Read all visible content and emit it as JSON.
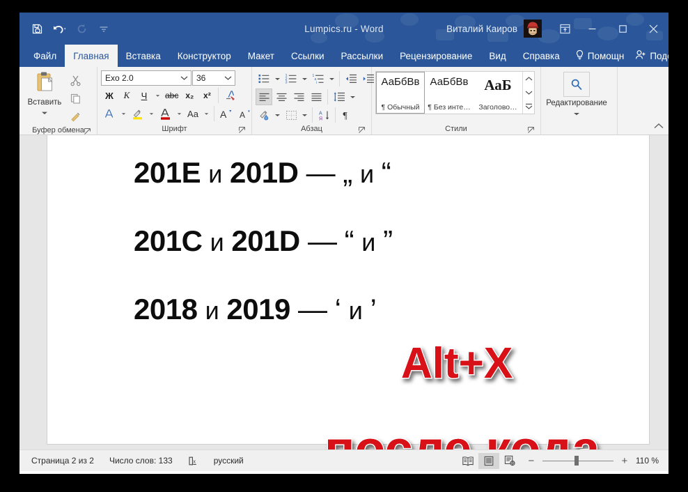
{
  "window": {
    "title": "Lumpics.ru  -  Word",
    "user": "Виталий Каиров",
    "quick_access": [
      {
        "name": "save",
        "label": "Сохранить"
      },
      {
        "name": "undo",
        "label": "Отменить"
      },
      {
        "name": "redo",
        "label": "Вернуть"
      },
      {
        "name": "customize",
        "label": "Настройка панели быстрого доступа"
      }
    ],
    "buttons": {
      "ribbon_display": "Параметры отображения ленты",
      "minimize": "Свернуть",
      "maximize": "Развернуть",
      "close": "Закрыть"
    }
  },
  "tabs": [
    {
      "label": "Файл",
      "active": false
    },
    {
      "label": "Главная",
      "active": true
    },
    {
      "label": "Вставка",
      "active": false
    },
    {
      "label": "Конструктор",
      "active": false
    },
    {
      "label": "Макет",
      "active": false
    },
    {
      "label": "Ссылки",
      "active": false
    },
    {
      "label": "Рассылки",
      "active": false
    },
    {
      "label": "Рецензирование",
      "active": false
    },
    {
      "label": "Вид",
      "active": false
    },
    {
      "label": "Справка",
      "active": false
    }
  ],
  "tabstrip_right": {
    "help_label": "Помощн",
    "share_label": "Поделиться"
  },
  "ribbon": {
    "groups": {
      "clipboard": {
        "label": "Буфер обмена",
        "paste_label": "Вставить",
        "cut_label": "Вырезать",
        "copy_label": "Копировать",
        "format_painter_label": "Формат по образцу"
      },
      "font": {
        "label": "Шрифт",
        "font_name": "Exo 2.0",
        "font_size": "36",
        "bold": "Ж",
        "italic": "К",
        "underline": "Ч",
        "strikethrough": "abc",
        "subscript": "x₂",
        "superscript": "x²",
        "clear_format_label": "Очистить формат",
        "text_effects_label": "Текстовые эффекты",
        "highlight_label": "Цвет выделения текста",
        "font_color_label": "Цвет шрифта",
        "change_case": "Aa",
        "grow_font": "A",
        "shrink_font": "A"
      },
      "paragraph": {
        "label": "Абзац",
        "bullets_label": "Маркеры",
        "numbering_label": "Нумерация",
        "multilevel_label": "Многоуровневый список",
        "decrease_indent_label": "Уменьшить отступ",
        "increase_indent_label": "Увеличить отступ",
        "align_left_label": "По левому краю",
        "align_center_label": "По центру",
        "align_right_label": "По правому краю",
        "justify_label": "По ширине",
        "line_spacing_label": "Интервал",
        "shading_label": "Заливка",
        "borders_label": "Границы",
        "sort_label": "Сортировка",
        "marks_label": "Отобразить все знаки"
      },
      "styles": {
        "label": "Стили",
        "items": [
          {
            "preview": "АаБбВв",
            "name": "¶ Обычный",
            "selected": true,
            "heading": false
          },
          {
            "preview": "АаБбВв",
            "name": "¶ Без инте…",
            "selected": false,
            "heading": false
          },
          {
            "preview": "АаБ",
            "name": "Заголово…",
            "selected": false,
            "heading": true
          }
        ]
      },
      "editing": {
        "label": "Редактирование",
        "icon": "search-icon"
      }
    },
    "collapse_label": "Свернуть ленту"
  },
  "document": {
    "lines": [
      {
        "code1": "201E",
        "conj": "и",
        "code2": "201D",
        "dash": "—",
        "q_open": "„",
        "mid": "и",
        "q_close": "“"
      },
      {
        "code1": "201C",
        "conj": "и",
        "code2": "201D",
        "dash": "—",
        "q_open": "“",
        "mid": "и",
        "q_close": "”"
      },
      {
        "code1": "2018",
        "conj": "и",
        "code2": "2019",
        "dash": "—",
        "q_open": "‘",
        "mid": "и",
        "q_close": "’"
      }
    ],
    "annotations": [
      {
        "text": "Alt+X",
        "color": "#d81118"
      },
      {
        "text": "после кода",
        "color": "#d81118"
      }
    ]
  },
  "statusbar": {
    "page": "Страница 2 из 2",
    "words": "Число слов: 133",
    "proofing_label": "Проверка правописания",
    "language": "русский",
    "views": [
      {
        "name": "read-mode",
        "selected": false
      },
      {
        "name": "print-layout",
        "selected": true
      },
      {
        "name": "web-layout",
        "selected": false
      }
    ],
    "zoom_out": "−",
    "zoom_in": "+",
    "zoom_value": "110 %"
  }
}
